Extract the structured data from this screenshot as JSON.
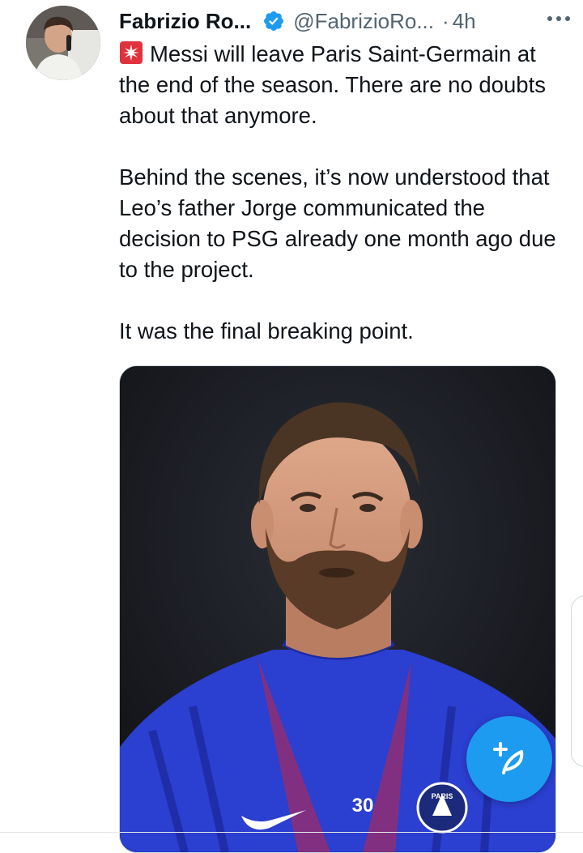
{
  "tweet": {
    "author_name": "Fabrizio Ro...",
    "handle": "@FabrizioRo...",
    "separator": "·",
    "time": "4h",
    "lines": [
      "Messi will leave Paris Saint-Germain at the end of the season. There are no doubts about that anymore.",
      "Behind the scenes, it’s now understood that Leo’s father Jorge communicated the decision to PSG already one month ago due to the project.",
      "It was the final breaking point."
    ],
    "media": {
      "jersey_number": "30",
      "crest_text": "PARIS"
    }
  },
  "icons": {
    "verified": "verified-badge-icon",
    "more": "more-dots-icon",
    "siren": "rotating-light-emoji",
    "compose": "compose-feather-icon"
  },
  "colors": {
    "accent": "#1d9bf0",
    "text": "#0f1419",
    "secondary": "#536471",
    "jersey": "#2b3fd0"
  }
}
